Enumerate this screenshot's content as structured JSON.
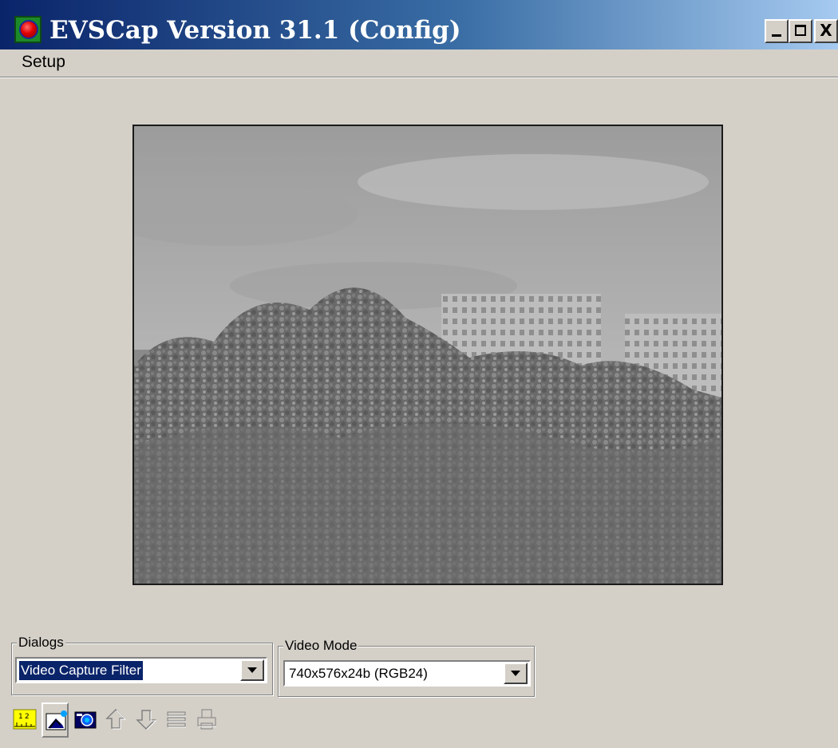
{
  "window": {
    "title": "EVSCap Version 31.1 (Config)",
    "controls": {
      "minimize": "_",
      "maximize": "□",
      "close": "X"
    }
  },
  "menubar": {
    "items": [
      {
        "label": "Setup"
      }
    ]
  },
  "preview": {
    "description_icon": "camera-preview"
  },
  "dialogs": {
    "group_label": "Dialogs",
    "selected": "Video Capture Filter"
  },
  "video_mode": {
    "group_label": "Video Mode",
    "selected": "740x576x24b (RGB24)"
  },
  "toolbar": {
    "buttons": [
      {
        "icon": "ruler-scale-icon",
        "enabled": true
      },
      {
        "icon": "capture-wand-icon",
        "enabled": true
      },
      {
        "icon": "camera-icon",
        "enabled": true
      },
      {
        "icon": "upload-icon",
        "enabled": false
      },
      {
        "icon": "download-icon",
        "enabled": false
      },
      {
        "icon": "list-icon",
        "enabled": false
      },
      {
        "icon": "print-icon",
        "enabled": false
      }
    ]
  },
  "colors": {
    "titlebar_start": "#0a246a",
    "titlebar_end": "#a6caf0",
    "face": "#d4d0c8",
    "selection": "#0a246a"
  }
}
